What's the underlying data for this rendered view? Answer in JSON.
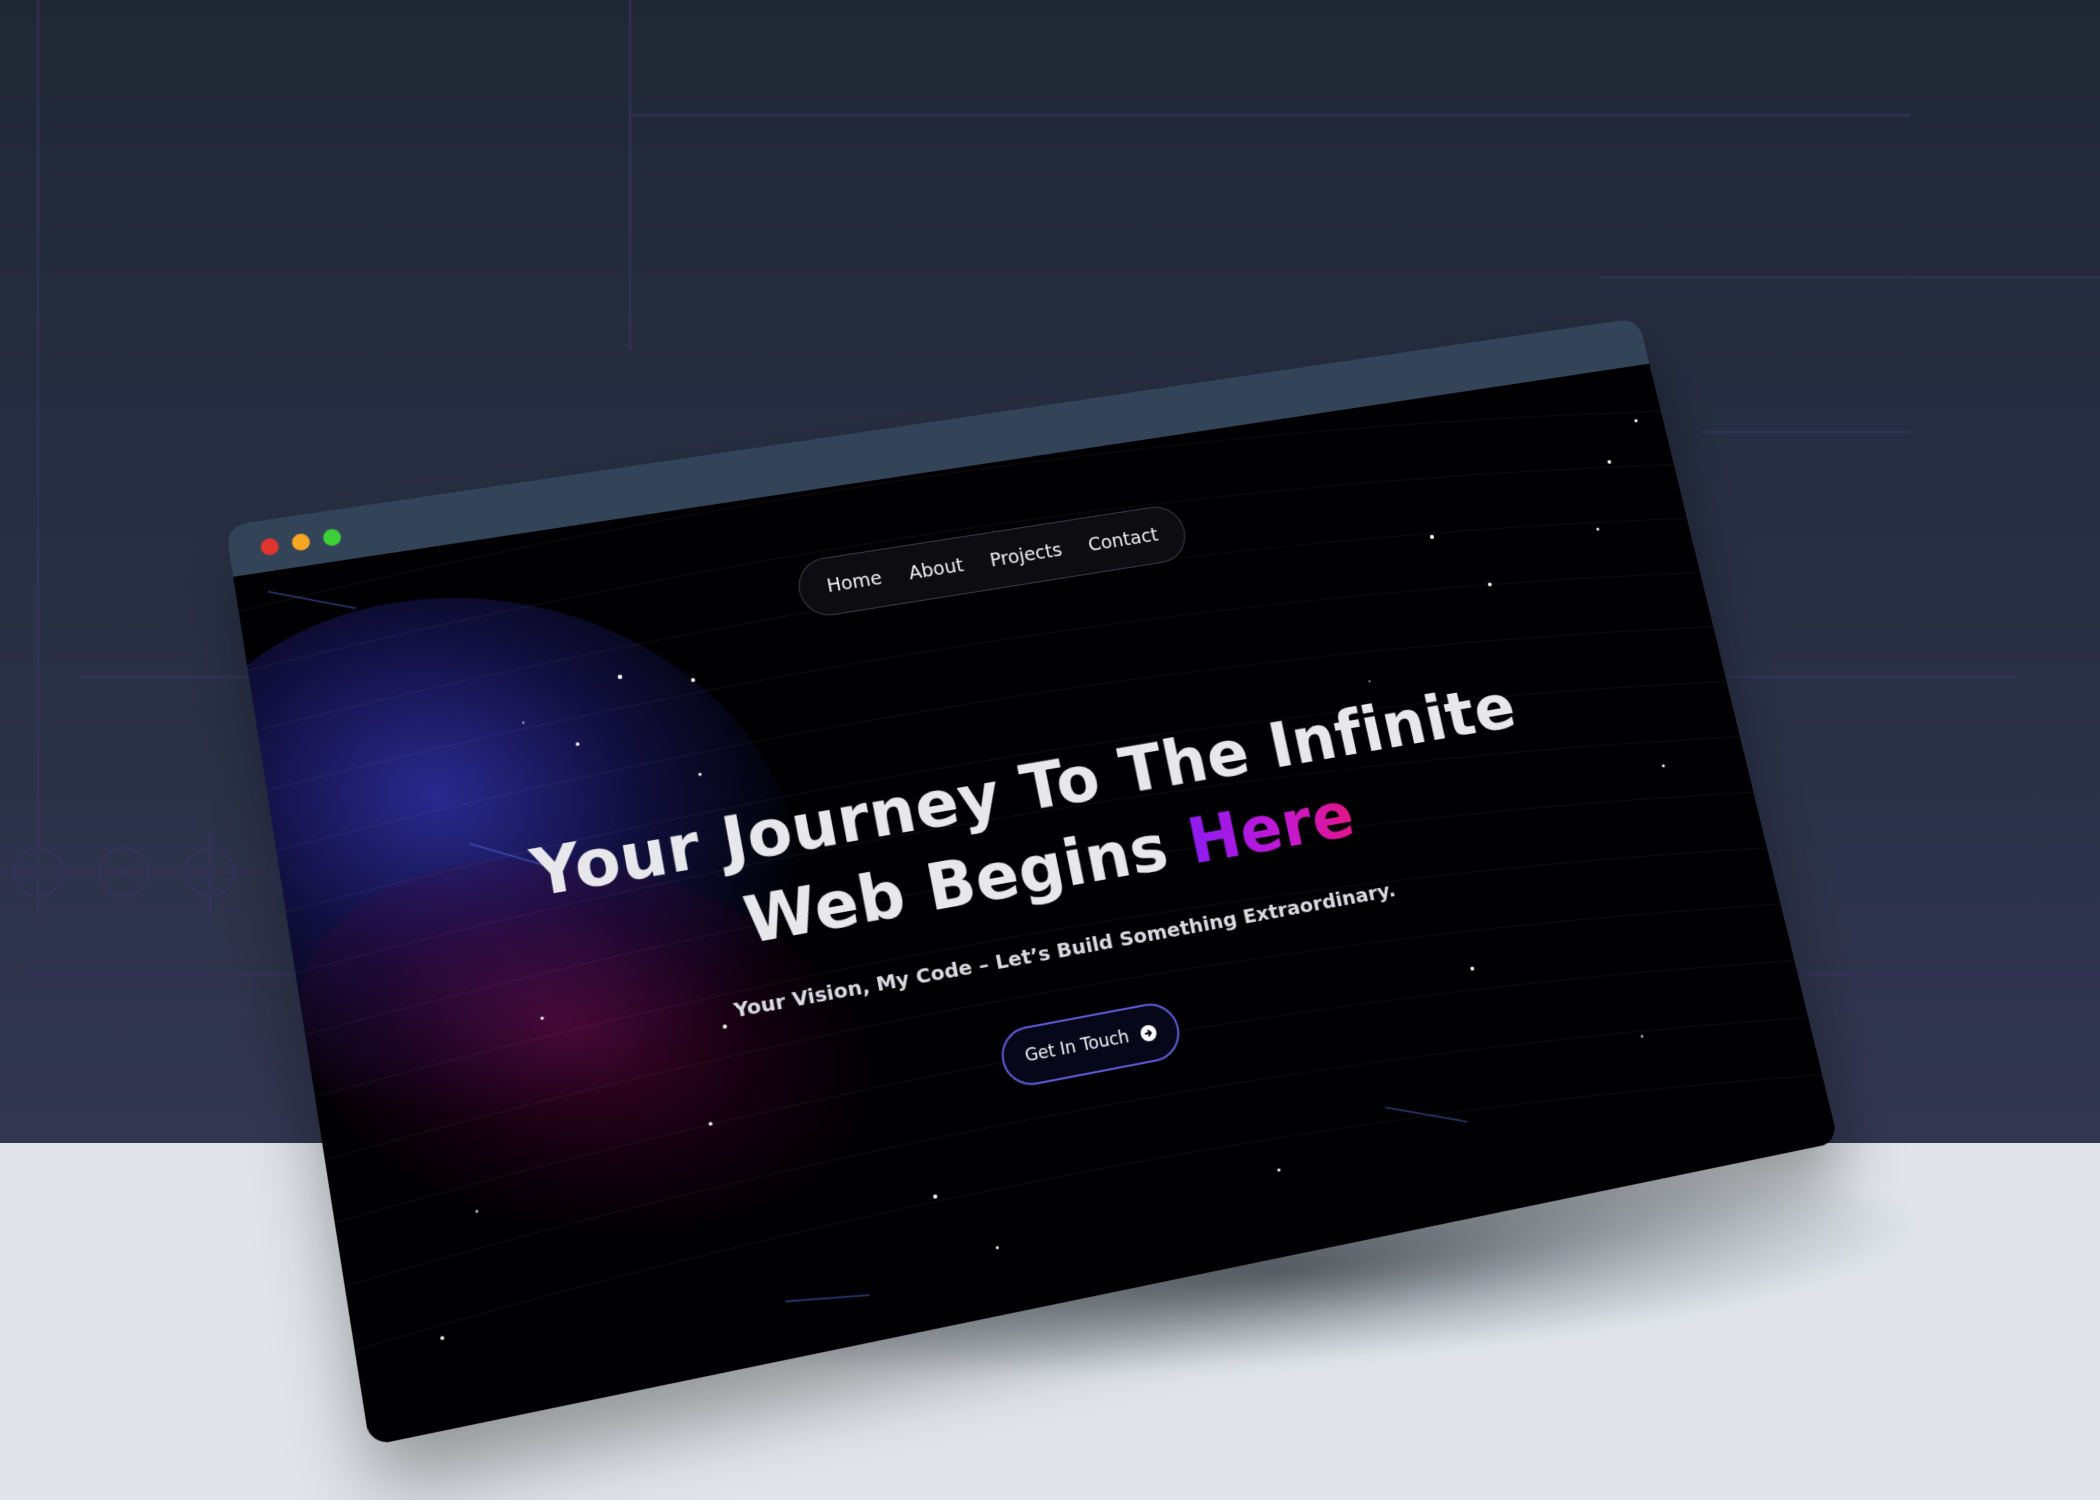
{
  "nav": {
    "items": [
      {
        "label": "Home"
      },
      {
        "label": "About"
      },
      {
        "label": "Projects"
      },
      {
        "label": "Contact"
      }
    ]
  },
  "hero": {
    "line1": "Your Journey To The Infinite",
    "line2_prefix": "Web Begins ",
    "line2_accent": "Here",
    "subtitle": "Your Vision, My Code – Let’s Build Something Extraordinary."
  },
  "cta": {
    "label": "Get In Touch",
    "icon": "arrow-right-circle-icon"
  },
  "window_controls": {
    "close_color": "#e0342f",
    "minimize_color": "#f5a623",
    "maximize_color": "#3ccf3a"
  },
  "colors": {
    "titlebar": "#334459",
    "page_background": "#000002",
    "accent_gradient_start": "#8b1cf0",
    "accent_gradient_end": "#e51586",
    "cta_border": "#5b5bd6"
  }
}
